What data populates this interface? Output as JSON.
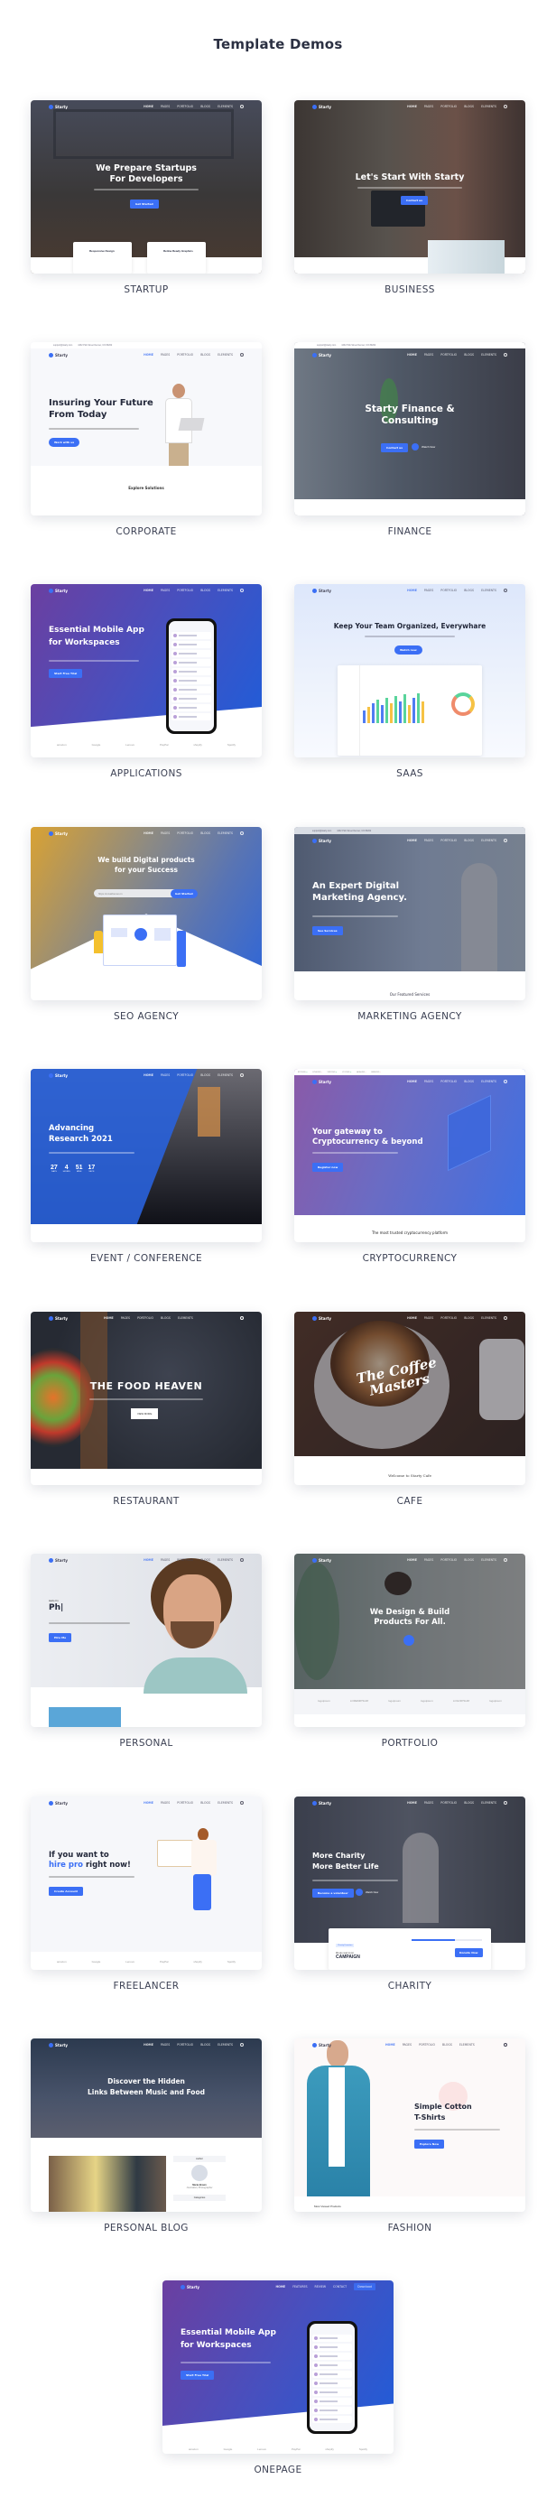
{
  "page": {
    "title": "Template Demos"
  },
  "brand": {
    "name": "Starty",
    "accent": "#3b6ff5"
  },
  "nav": [
    "HOME",
    "PAGES",
    "PORTFOLIO",
    "BLOGS",
    "ELEMENTS"
  ],
  "onepage_nav": [
    "HOME",
    "FEATURES",
    "REVIEW",
    "CONTACT",
    "Download"
  ],
  "topbar": {
    "email": "support@starty.com",
    "address": "4432 Pick Street Denver, CO 80202"
  },
  "demos": [
    {
      "label": "STARTUP",
      "heading": [
        "We Prepare Startups",
        "For Developers"
      ],
      "button": "Get Started",
      "features": [
        "Responsive Design",
        "Retina Ready Graphics"
      ]
    },
    {
      "label": "BUSINESS",
      "heading": [
        "Let's Start With Starty"
      ],
      "button": "Contact us"
    },
    {
      "label": "CORPORATE",
      "heading": [
        "Insuring Your Future",
        "From Today"
      ],
      "button": "Work with us",
      "section": "Explore Solutions"
    },
    {
      "label": "FINANCE",
      "heading": [
        "Starty Finance &",
        "Consulting"
      ],
      "button": "Contact us",
      "secondary": "Watch Now"
    },
    {
      "label": "APPLICATIONS",
      "heading": [
        "Essential Mobile App",
        "for Workspaces"
      ],
      "button": "Start Free Trial",
      "partners": [
        "amazon",
        "Google",
        "Lenovo",
        "PayPal",
        "shopify",
        "Spotify"
      ]
    },
    {
      "label": "SAAS",
      "heading": [
        "Keep Your Team Organized, Everywhare"
      ],
      "button": "Watch now"
    },
    {
      "label": "SEO AGENCY",
      "heading": [
        "We build Digital products",
        "for your Success"
      ],
      "button": "Get Started",
      "input_value": "https://envathemes.in"
    },
    {
      "label": "MARKETING AGENCY",
      "heading": [
        "An Expert Digital",
        "Marketing Agency."
      ],
      "button": "See Services",
      "section": "Our Featured Services"
    },
    {
      "label": "EVENT / CONFERENCE",
      "heading": [
        "Advancing",
        "Research 2021"
      ],
      "countdown": [
        {
          "value": "27",
          "unit": "DAYS"
        },
        {
          "value": "4",
          "unit": "HOURS"
        },
        {
          "value": "51",
          "unit": "MINS"
        },
        {
          "value": "17",
          "unit": "SECS"
        }
      ]
    },
    {
      "label": "CRYPTOCURRENCY",
      "heading": [
        "Your gateway to",
        "Cryptocurrency & beyond"
      ],
      "button": "Register now",
      "section": "The most trusted cryptocurrency platform"
    },
    {
      "label": "RESTAURANT",
      "heading": [
        "THE FOOD HEAVEN"
      ],
      "button": "VIEW MORE"
    },
    {
      "label": "CAFE",
      "heading": [
        "The Coffee",
        "Masters"
      ],
      "section": "Welcome to Starty Cafe"
    },
    {
      "label": "PERSONAL",
      "kicker": "Hello I'm",
      "heading": [
        "Ph|"
      ],
      "button": "Hire Me"
    },
    {
      "label": "PORTFOLIO",
      "heading": [
        "We Design & Build",
        "Products For All."
      ],
      "partners": [
        "logoipsum",
        "LOREMIPSUM",
        "logoipsum",
        "logoipsum",
        "LOGOIPSUM",
        "logoipsum"
      ]
    },
    {
      "label": "FREELANCER",
      "heading": [
        "If you want to",
        "hire pro",
        " right now!"
      ],
      "button": "Create Account",
      "partners": [
        "amazon",
        "Google",
        "Lenovo",
        "PayPal",
        "shopify",
        "Spotify"
      ]
    },
    {
      "label": "CHARITY",
      "heading": [
        "More Charity",
        "More Better Life"
      ],
      "button": "Become a volunteer",
      "secondary": "Watch Now",
      "campaign": {
        "tag": "Charity Donation",
        "kicker": "We are near to our",
        "title": "CAMPAIGN",
        "button": "Donate Now",
        "progress": 0.62
      }
    },
    {
      "label": "PERSONAL BLOG",
      "heading": [
        "Discover the Hidden",
        "Links Between Music and Food"
      ],
      "sidebar": {
        "author_title": "Author",
        "author": "Maria Brown",
        "role": "Journalist | Photographer",
        "categories": "Categories"
      }
    },
    {
      "label": "FASHION",
      "heading": [
        "Simple Cotton",
        "T-Shirts"
      ],
      "button": "Explore Now",
      "section": "Most Viewed Products"
    },
    {
      "label": "ONEPAGE",
      "heading": [
        "Essential Mobile App",
        "for Workspaces"
      ],
      "button": "Start Free Trial",
      "partners": [
        "amazon",
        "Google",
        "Lenovo",
        "PayPal",
        "shopify",
        "Spotify"
      ]
    }
  ]
}
